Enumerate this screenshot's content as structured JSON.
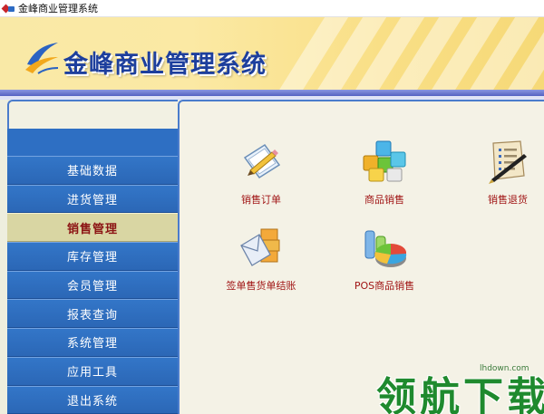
{
  "window": {
    "title": "金峰商业管理系统"
  },
  "banner": {
    "title": "金峰商业管理系统"
  },
  "nav": {
    "items": [
      {
        "label": "基础数据"
      },
      {
        "label": "进货管理"
      },
      {
        "label": "销售管理",
        "active": true
      },
      {
        "label": "库存管理"
      },
      {
        "label": "会员管理"
      },
      {
        "label": "报表查询"
      },
      {
        "label": "系统管理"
      },
      {
        "label": "应用工具"
      },
      {
        "label": "退出系统"
      }
    ]
  },
  "main": {
    "tiles": [
      {
        "label": "销售订单",
        "icon": "pencil-document-icon"
      },
      {
        "label": "商品销售",
        "icon": "colored-cubes-icon"
      },
      {
        "label": "销售退货",
        "icon": "return-list-pen-icon"
      },
      {
        "label": "签单售货单结账",
        "icon": "envelope-boxes-icon"
      },
      {
        "label": "POS商品销售",
        "icon": "pie-chart-icon"
      }
    ]
  },
  "watermark": {
    "text": "领航下载",
    "site": "lhdown.com"
  },
  "colors": {
    "nav_blue": "#2e6fc3",
    "nav_active": "#d9d6a3",
    "label_red": "#a11616",
    "banner_title": "#1d3f9d"
  }
}
